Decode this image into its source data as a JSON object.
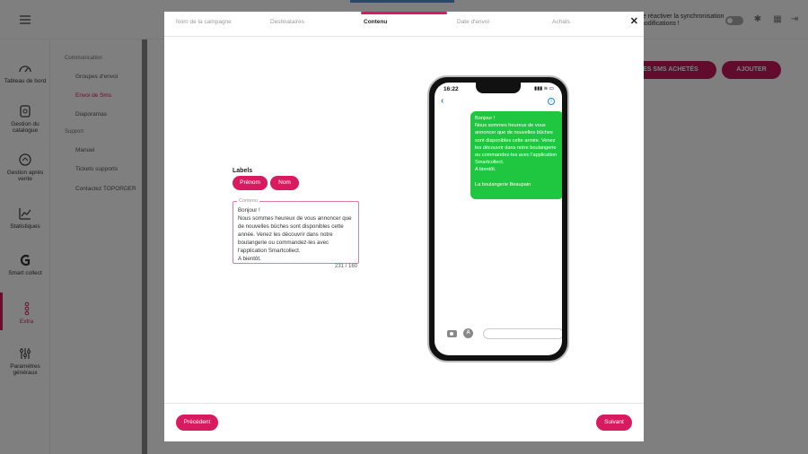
{
  "header": {
    "sync_text_line1": "de réactiver la synchronisation",
    "sync_text_line2": "modifications !"
  },
  "sidebar": {
    "items": [
      {
        "label": "Tableau de bord",
        "icon": "dashboard-icon"
      },
      {
        "label": "Gestion du catalogue",
        "icon": "catalog-icon"
      },
      {
        "label": "Gestion après vente",
        "icon": "after-sales-icon"
      },
      {
        "label": "Statistiques",
        "icon": "stats-icon"
      },
      {
        "label": "Smart collect",
        "icon": "smart-collect-icon"
      },
      {
        "label": "Extra",
        "icon": "extra-icon"
      },
      {
        "label": "Paramètres généraux",
        "icon": "settings-icon"
      }
    ]
  },
  "submenu": {
    "section1": "Communication",
    "items1": [
      "Groupes d'envoi",
      "Envoi de Sms",
      "Diaporamas"
    ],
    "section2": "Support",
    "items2": [
      "Manuel",
      "Tickets supports",
      "Contactez TOPORDER"
    ]
  },
  "background_buttons": {
    "buy_sms": "MES SMS ACHETÉS",
    "add": "AJOUTER"
  },
  "modal": {
    "steps": [
      "Nom de la campagne",
      "Destinataires",
      "Contenu",
      "Date d'envoi",
      "Achats"
    ],
    "active_step": "Contenu",
    "close": "✕",
    "labels_title": "Labels",
    "chips": [
      "Prénom",
      "Nom"
    ],
    "content_legend": "Contenu",
    "content_text": "Bonjour !\nNous sommes heureux de vous annoncer que de nouvelles bûches sont disponibles cette année. Venez les découvrir dans notre boulangerie ou commandez-les avec l'application Smartcollect.\nA bientôt.",
    "counter": "231 / 160",
    "prev_button": "Précédent",
    "next_button": "Suivant"
  },
  "phone": {
    "time": "16:22",
    "status": "▮▮▮ ≋ ▭",
    "back": "‹",
    "info": "i",
    "bubble_text": "Bonjour !\nNous sommes heureux de vous annoncer que de nouvelles bûches sont disponibles cette année. Venez les découvrir dans notre boulangerie ou commandez-les avec l'application Smartcollect.\nA bientôt.\n\nLa boulangerie Beaupain",
    "app_icon": "A"
  },
  "colors": {
    "accent": "#d81b60",
    "bubble": "#1fc63f",
    "ios_blue": "#1e88e5"
  }
}
